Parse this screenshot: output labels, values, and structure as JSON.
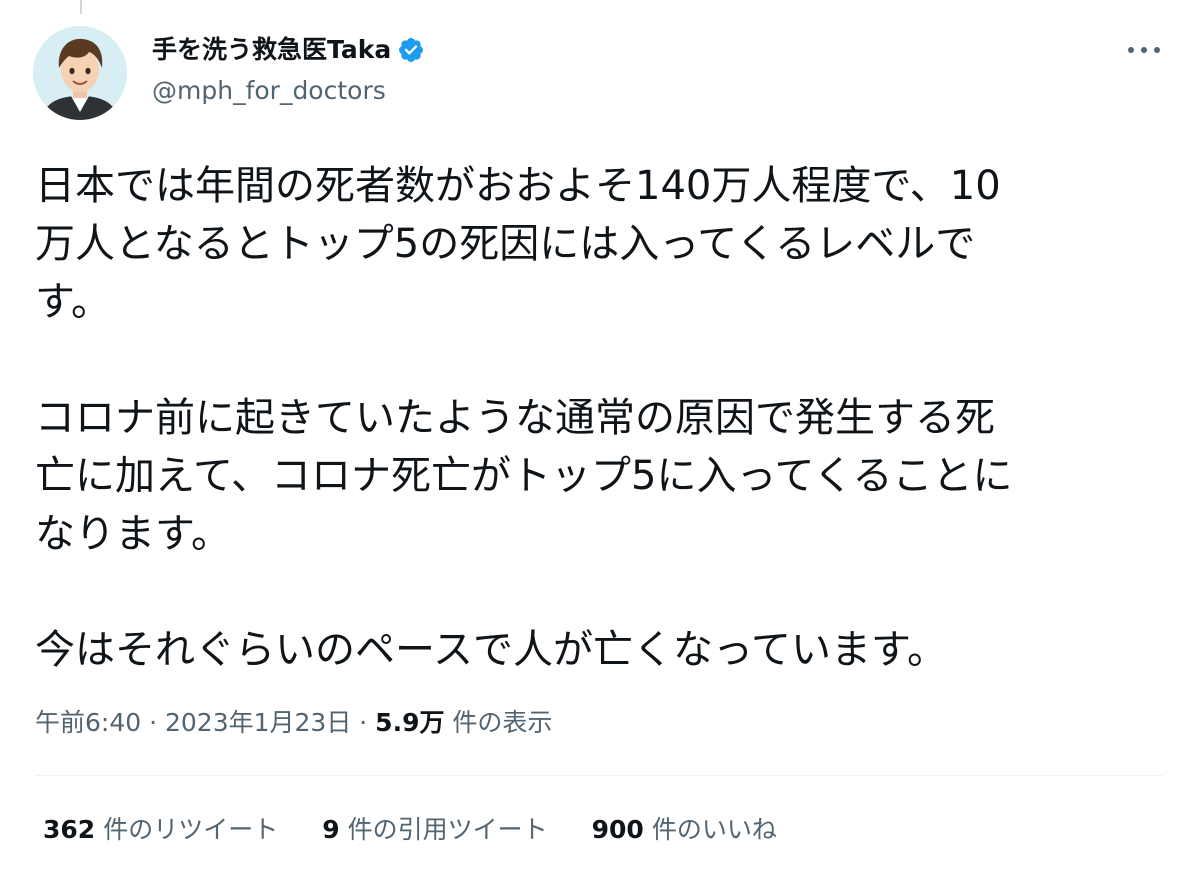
{
  "author": {
    "display_name": "手を洗う救急医Taka",
    "handle": "@mph_for_doctors",
    "verified": true,
    "verified_color": "#1d9bf0"
  },
  "tweet": {
    "paragraphs": [
      "日本では年間の死者数がおおよそ140万人程度で、10\n万人となるとトップ5の死因には入ってくるレベルで\nす。",
      "コロナ前に起きていたような通常の原因で発生する死\n亡に加えて、コロナ死亡がトップ5に入ってくることに\nなります。",
      "今はそれぐらいのペースで人が亡くなっています。"
    ]
  },
  "meta": {
    "time": "午前6:40",
    "separator1": " · ",
    "date": "2023年1月23日",
    "separator2": " · ",
    "views_count": "5.9万",
    "views_label": "件の表示"
  },
  "stats": {
    "retweets_count": "362",
    "retweets_label": "件のリツイート",
    "quotes_count": "9",
    "quotes_label": "件の引用ツイート",
    "likes_count": "900",
    "likes_label": "件のいいね"
  },
  "icons": {
    "more": "more-options-icon",
    "verified": "verified-badge-icon"
  }
}
